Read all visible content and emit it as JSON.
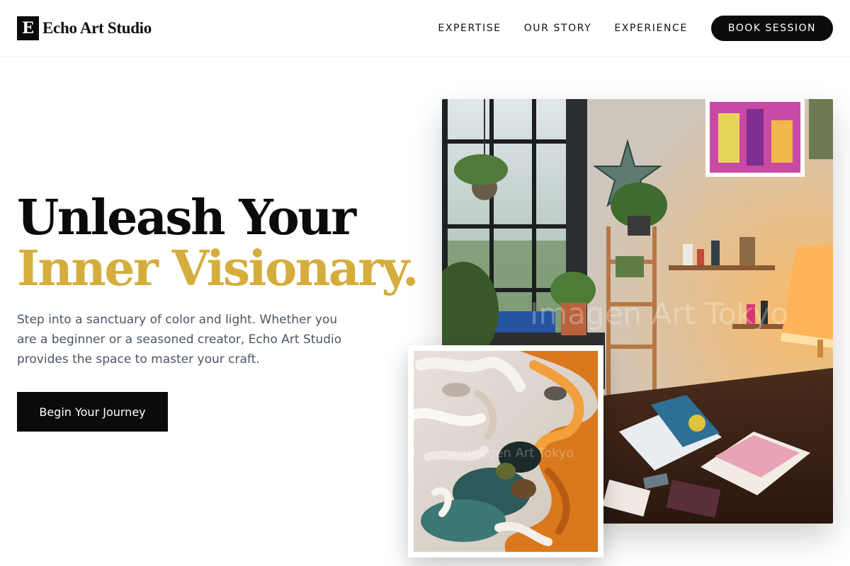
{
  "brand": {
    "mark": "E",
    "name": "Echo Art Studio"
  },
  "nav": {
    "links": [
      "EXPERTISE",
      "OUR STORY",
      "EXPERIENCE"
    ],
    "cta": "BOOK SESSION"
  },
  "hero": {
    "headline_line1": "Unleash Your",
    "headline_line2": "Inner Visionary.",
    "description": "Step into a sanctuary of color and light. Whether you are a beginner or a seasoned creator, Echo Art Studio provides the space to master your craft.",
    "cta": "Begin Your Journey"
  },
  "images": {
    "main_watermark": "Imagen Art Tokyo",
    "inset_watermark": "Imagen Art Tokyo"
  },
  "colors": {
    "accent_gold": "#d4ad3d",
    "primary_black": "#0b0b0b",
    "body_text": "#4b5563"
  }
}
